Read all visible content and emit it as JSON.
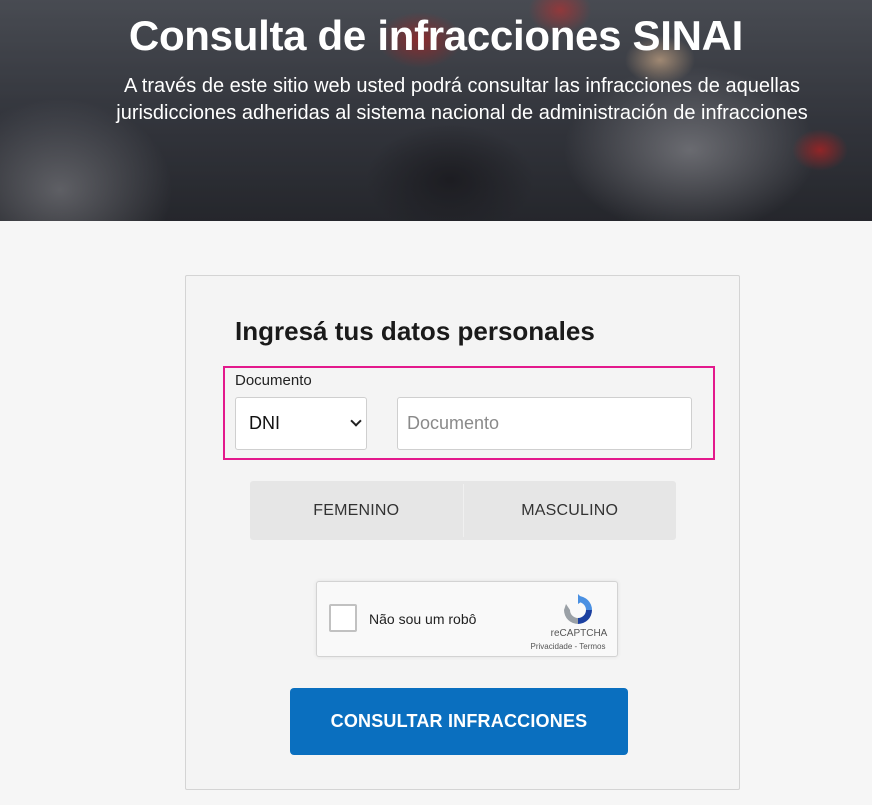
{
  "hero": {
    "title": "Consulta de infracciones SINAI",
    "subtitle": "A través de este sitio web usted podrá consultar las infracciones de aquellas jurisdicciones adheridas al sistema nacional de administración de infracciones"
  },
  "form": {
    "heading": "Ingresá tus datos personales",
    "document_label": "Documento",
    "document_type_value": "DNI",
    "document_placeholder": "Documento",
    "gender_options": [
      "FEMENINO",
      "MASCULINO"
    ],
    "captcha": {
      "label": "Não sou um robô",
      "brand": "reCAPTCHA",
      "links": "Privacidade - Termos"
    },
    "submit_label": "CONSULTAR INFRACCIONES"
  },
  "colors": {
    "highlight": "#e3198c",
    "primary_button": "#0a6fbf"
  }
}
